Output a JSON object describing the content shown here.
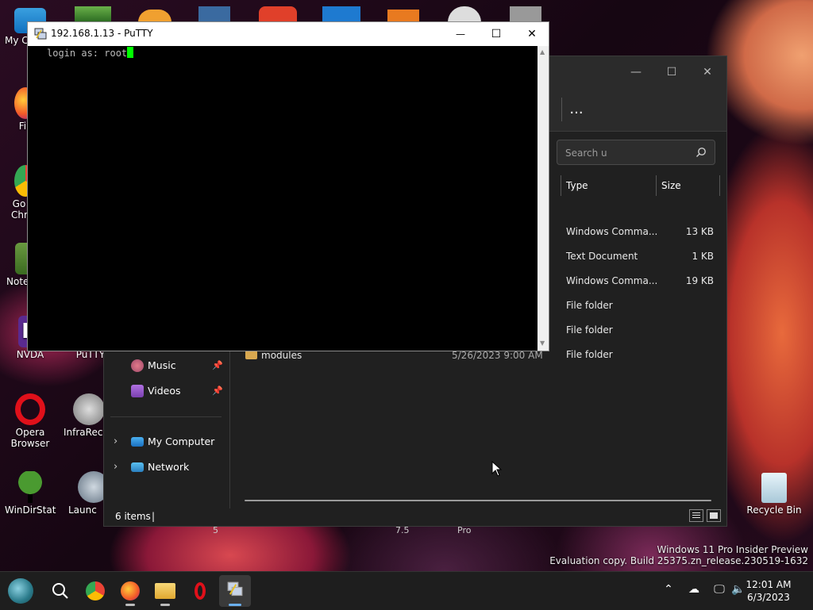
{
  "desktop": {
    "icons": [
      {
        "label": "My Co"
      },
      {
        "label": "Fir"
      },
      {
        "label": "Go Chr"
      },
      {
        "label": "Note"
      },
      {
        "label": "NVDA"
      },
      {
        "label": "PuTTY"
      },
      {
        "label": "Opera Browser"
      },
      {
        "label": "InfraReco"
      },
      {
        "label": "WinDirStat"
      },
      {
        "label": "Launc"
      },
      {
        "label": "Recycle Bin"
      }
    ],
    "watermark": {
      "line1": "Windows 11 Pro Insider Preview",
      "line2": "Evaluation copy. Build 25375.zn_release.230519-1632"
    },
    "stray_labels": [
      "5",
      "7.5",
      "Pro"
    ]
  },
  "putty": {
    "title": "192.168.1.13 - PuTTY",
    "terminal_text": "login as: root",
    "controls": {
      "minimize": "—",
      "maximize": "☐",
      "close": "✕"
    }
  },
  "explorer": {
    "more_label": "...",
    "search_placeholder": "Search u",
    "columns": [
      "Type",
      "Size"
    ],
    "files": [
      {
        "type": "Windows Comma...",
        "size": "13 KB"
      },
      {
        "type": "Text Document",
        "size": "1 KB"
      },
      {
        "type": "Windows Comma...",
        "size": "19 KB"
      },
      {
        "type": "File folder",
        "size": ""
      },
      {
        "type": "File folder",
        "size": ""
      },
      {
        "type": "File folder",
        "size": ""
      }
    ],
    "visible_folder": {
      "name": "modules",
      "date": "5/26/2023 9:00 AM"
    },
    "nav": [
      {
        "label": "Music"
      },
      {
        "label": "Videos"
      },
      {
        "label": "My Computer"
      },
      {
        "label": "Network"
      }
    ],
    "status": {
      "count": "6 items"
    }
  },
  "taskbar": {
    "time": "12:01 AM",
    "date": "6/3/2023"
  },
  "colors": {
    "terminal_bg": "#000000",
    "terminal_cursor": "#00ff00",
    "explorer_bg": "#202020"
  }
}
